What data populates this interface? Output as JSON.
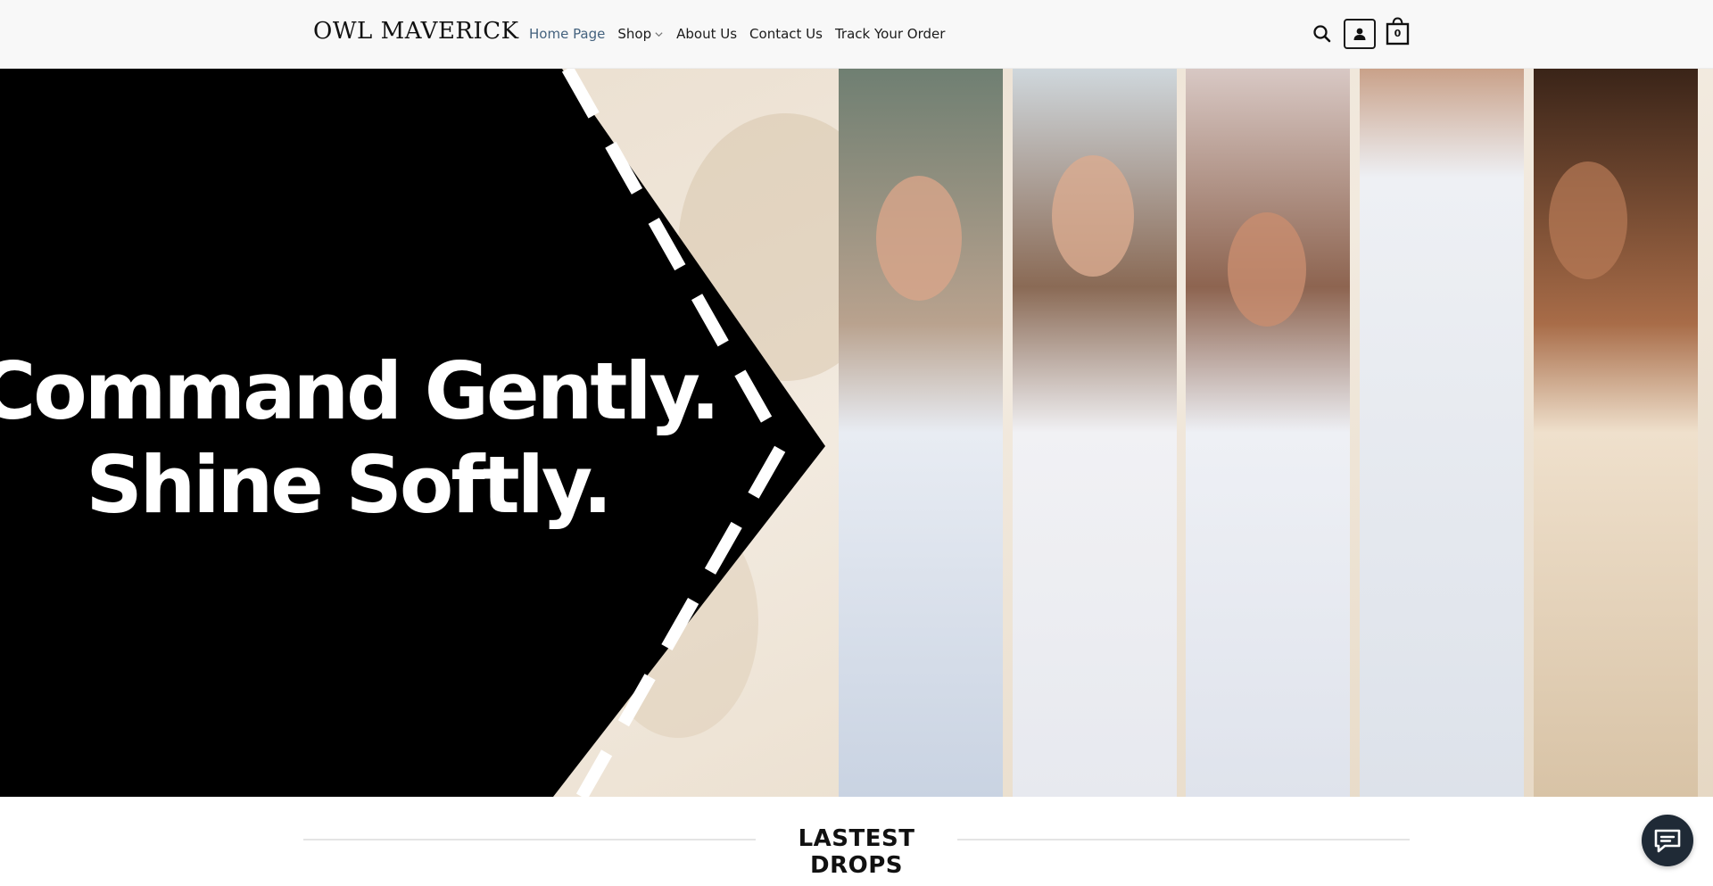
{
  "header": {
    "logo": "OWL MAVERICK",
    "nav": {
      "home": "Home Page",
      "shop": "Shop",
      "about": "About Us",
      "contact": "Contact Us",
      "track": "Track Your Order"
    },
    "cart_count": "0"
  },
  "hero": {
    "line1": "Command Gently.",
    "line2": "Shine Softly."
  },
  "section": {
    "title": "LASTEST DROPS"
  },
  "icons": {
    "search": "search-icon",
    "account": "user-icon",
    "cart": "shopping-bag-icon",
    "chat": "chat-icon",
    "shop_chevron": "chevron-down-icon"
  },
  "colors": {
    "header_bg": "#f8f8f8",
    "active_nav": "#44627e",
    "hero_black": "#000000",
    "hero_beige": "#efe6da",
    "chat_bg": "#1f2a36"
  }
}
